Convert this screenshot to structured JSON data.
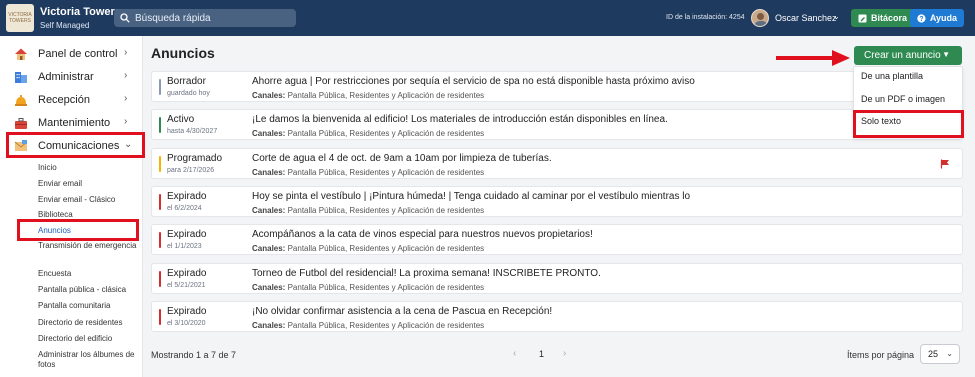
{
  "brand": {
    "logo_text": "VICTORIA TOWERS",
    "name": "Victoria Towers",
    "subtitle": "Self Managed"
  },
  "search": {
    "placeholder": "Búsqueda rápida"
  },
  "install_id": "ID de la instalación: 4254",
  "user": {
    "name": "Oscar Sanchez",
    "chevron": "⌄"
  },
  "topbar_buttons": {
    "log": "Bitácora",
    "help": "Ayuda"
  },
  "colors": {
    "topbar": "#1f3a5f",
    "primary_green": "#2e8a50",
    "help_blue": "#1e7ad3",
    "status_draft": "#8a9bb4",
    "status_active": "#2e8a50",
    "status_scheduled": "#f5b400",
    "status_expired": "#d32f2f",
    "annotation_red": "#e0101e"
  },
  "sidebar": {
    "items": [
      {
        "label": "Panel de control",
        "icon": "house-icon",
        "chevron": "›"
      },
      {
        "label": "Administrar",
        "icon": "buildings-icon",
        "chevron": "›"
      },
      {
        "label": "Recepción",
        "icon": "bell-icon",
        "chevron": "›"
      },
      {
        "label": "Mantenimiento",
        "icon": "toolbox-icon",
        "chevron": "›"
      },
      {
        "label": "Comunicaciones",
        "icon": "envelope-icon",
        "chevron": "⌄"
      }
    ],
    "sub_items": [
      "Inicio",
      "Enviar email",
      "Enviar email - Clásico",
      "Biblioteca",
      "Anuncios",
      "Transmisión de emergencia",
      "Encuesta",
      "Pantalla pública - clásica",
      "Pantalla comunitaria",
      "Directorio de residentes",
      "Directorio del edificio",
      "Administrar los álbumes de fotos"
    ]
  },
  "main": {
    "title": "Anuncios",
    "create_button": "Crear un anuncio",
    "create_menu": [
      "De una plantilla",
      "De un PDF o imagen",
      "Solo texto"
    ],
    "channels_label": "Canales:",
    "announcements": [
      {
        "status": "Borrador",
        "date": "guardado hoy",
        "status_color": "#8a9bb4",
        "message": "Ahorre agua | Por restricciones por sequía el servicio de spa no está disponible hasta próximo aviso",
        "channels": "Pantalla Pública, Residentes y Aplicación de residentes",
        "flag": false
      },
      {
        "status": "Activo",
        "date": "hasta 4/30/2027",
        "status_color": "#2e8a50",
        "message": "¡Le damos la bienvenida al edificio! Los materiales de introducción están disponibles en línea.",
        "channels": "Pantalla Pública, Residentes y Aplicación de residentes",
        "flag": false
      },
      {
        "status": "Programado",
        "date": "para 2/17/2026",
        "status_color": "#f5b400",
        "message": "Corte de agua el 4 de oct. de 9am a 10am por limpieza de tuberías.",
        "channels": "Pantalla Pública, Residentes y Aplicación de residentes",
        "flag": true
      },
      {
        "status": "Expirado",
        "date": "el 6/2/2024",
        "status_color": "#d32f2f",
        "message": "Hoy se pinta el vestíbulo | ¡Pintura húmeda! | Tenga cuidado al caminar por el vestíbulo mientras lo",
        "channels": "Pantalla Pública, Residentes y Aplicación de residentes",
        "flag": false
      },
      {
        "status": "Expirado",
        "date": "el 1/1/2023",
        "status_color": "#d32f2f",
        "message": "Acompáñanos a la cata de vinos especial para nuestros nuevos propietarios!",
        "channels": "Pantalla Pública, Residentes y Aplicación de residentes",
        "flag": false
      },
      {
        "status": "Expirado",
        "date": "el 5/21/2021",
        "status_color": "#d32f2f",
        "message": "Torneo de Futbol del residencial! La proxima semana! INSCRIBETE PRONTO.",
        "channels": "Pantalla Pública, Residentes y Aplicación de residentes",
        "flag": false
      },
      {
        "status": "Expirado",
        "date": "el 3/10/2020",
        "status_color": "#d32f2f",
        "message": "¡No olvidar confirmar asistencia a la cena de Pascua en Recepción!",
        "channels": "Pantalla Pública, Residentes y Aplicación de residentes",
        "flag": false
      }
    ]
  },
  "footer": {
    "showing": "Mostrando 1 a 7 de 7",
    "page": "1",
    "prev": "‹",
    "next": "›",
    "per_page_label": "Ítems por página",
    "per_page_value": "25"
  }
}
